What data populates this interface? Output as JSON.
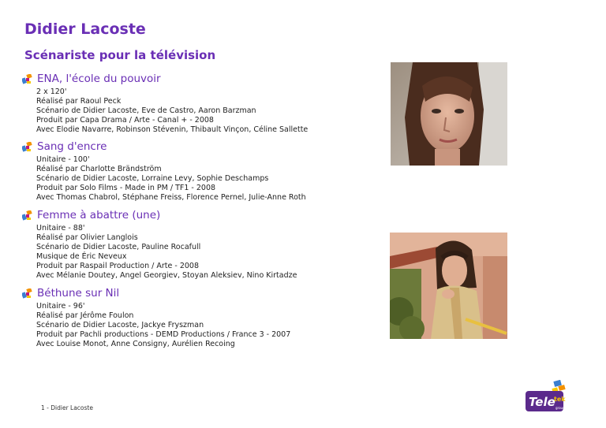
{
  "page": {
    "title": "Didier Lacoste",
    "subtitle": "Scénariste pour la télévision",
    "footer": "1 - Didier Lacoste"
  },
  "entries": [
    {
      "title": "ENA, l'école du pouvoir",
      "lines": [
        "2 x 120'",
        "Réalisé par Raoul Peck",
        "Scénario de Didier Lacoste, Eve de Castro, Aaron Barzman",
        "Produit par Capa Drama / Arte - Canal + - 2008",
        "Avec Elodie Navarre, Robinson Stévenin, Thibault Vinçon, Céline Sallette"
      ]
    },
    {
      "title": "Sang d'encre",
      "lines": [
        "Unitaire - 100'",
        "Réalisé par Charlotte Brändström",
        "Scénario de Didier Lacoste, Lorraine Levy, Sophie Deschamps",
        "Produit par Solo Films - Made in PM / TF1 - 2008",
        "Avec Thomas Chabrol, Stéphane Freiss, Florence Pernel, Julie-Anne Roth"
      ]
    },
    {
      "title": "Femme à abattre (une)",
      "lines": [
        "Unitaire - 88'",
        "Réalisé par Olivier Langlois",
        "Scénario de Didier Lacoste, Pauline Rocafull",
        "Musique de Éric Neveux",
        "Produit par Raspail Production / Arte - 2008",
        "Avec Mélanie Doutey, Angel Georgiev, Stoyan Aleksiev, Nino Kirtadze"
      ]
    },
    {
      "title": "Béthune sur Nil",
      "lines": [
        "Unitaire - 96'",
        "Réalisé par Jérôme Foulon",
        "Scénario de Didier Lacoste, Jackye Fryszman",
        "Produit par Pachli productions - DEMD Productions / France 3 - 2007",
        "Avec Louise Monot, Anne Consigny, Aurélien Recoing"
      ]
    }
  ],
  "logo": {
    "text_main": "Tele",
    "text_tek": "tek",
    "text_small": "group"
  },
  "colors": {
    "accent": "#6a2fb5",
    "body_text": "#222222",
    "bullet_orange": "#f39200",
    "bullet_blue": "#3a7fd0",
    "bullet_magenta": "#c2197a",
    "bullet_yellow": "#f6c800"
  }
}
